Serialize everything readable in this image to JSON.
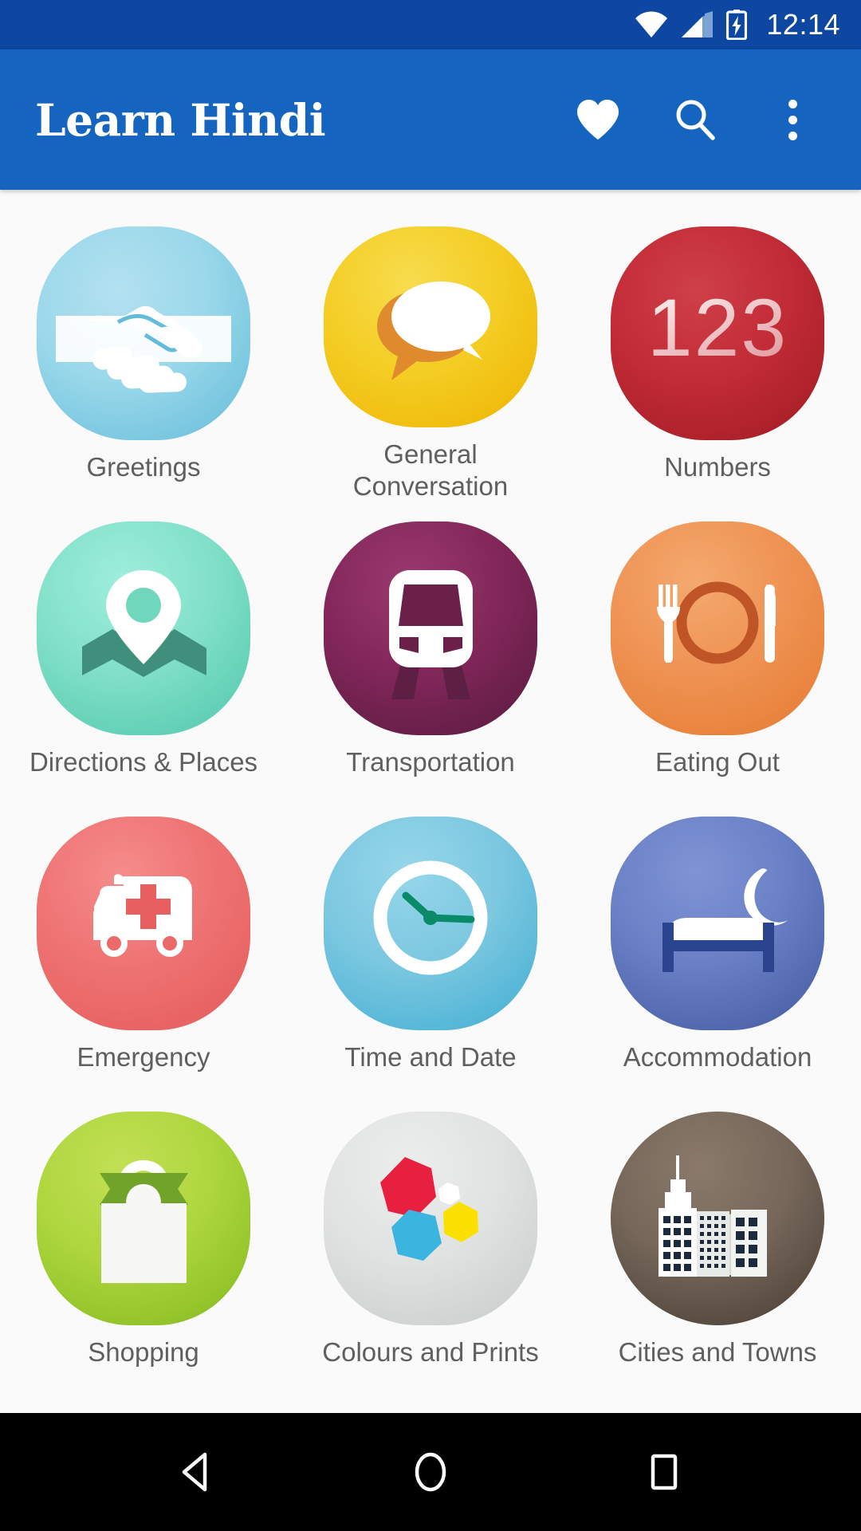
{
  "status_bar": {
    "time": "12:14",
    "icons": [
      "wifi-icon",
      "cellular-signal-icon",
      "battery-charging-icon"
    ],
    "background_color": "#0d47a1"
  },
  "app_bar": {
    "title": "Learn Hindi",
    "background_color": "#1565c0",
    "actions": [
      {
        "name": "favorites-icon",
        "label": "Favourites"
      },
      {
        "name": "search-icon",
        "label": "Search"
      },
      {
        "name": "overflow-menu-icon",
        "label": "More options"
      }
    ]
  },
  "grid": {
    "columns": 3,
    "tiles": [
      {
        "label": "Greetings",
        "icon": "handshake-icon",
        "bg_start": "#a5dcee",
        "bg_end": "#6cc2dd"
      },
      {
        "label": "General Conversation",
        "icon": "speech-bubbles-icon",
        "bg_start": "#f5d432",
        "bg_end": "#f0b800"
      },
      {
        "label": "Numbers",
        "icon": "numbers-123-icon",
        "bg_start": "#c8333d",
        "bg_end": "#a81d28"
      },
      {
        "label": "Directions & Places",
        "icon": "map-pin-icon",
        "bg_start": "#8fe3ce",
        "bg_end": "#5fcfb4"
      },
      {
        "label": "Transportation",
        "icon": "train-icon",
        "bg_start": "#8e2e62",
        "bg_end": "#5d1a42"
      },
      {
        "label": "Eating Out",
        "icon": "cutlery-plate-icon",
        "bg_start": "#f09a5a",
        "bg_end": "#e8833c"
      },
      {
        "label": "Emergency",
        "icon": "ambulance-icon",
        "bg_start": "#ef7a7a",
        "bg_end": "#e85c5c"
      },
      {
        "label": "Time and Date",
        "icon": "clock-icon",
        "bg_start": "#7ecbe4",
        "bg_end": "#47b3d6"
      },
      {
        "label": "Accommodation",
        "icon": "bed-moon-icon",
        "bg_start": "#6f86c9",
        "bg_end": "#4a63b5"
      },
      {
        "label": "Shopping",
        "icon": "shopping-bag-icon",
        "bg_start": "#b5d945",
        "bg_end": "#8cc02a"
      },
      {
        "label": "Colours and Prints",
        "icon": "hexagons-icon",
        "bg_start": "#e2e4e3",
        "bg_end": "#cdd1d0"
      },
      {
        "label": "Cities and Towns",
        "icon": "city-skyline-icon",
        "bg_start": "#7a6a5c",
        "bg_end": "#4e423a"
      }
    ]
  },
  "nav_bar": {
    "background_color": "#000000",
    "buttons": [
      {
        "name": "back-button",
        "label": "Back"
      },
      {
        "name": "home-button",
        "label": "Home"
      },
      {
        "name": "recents-button",
        "label": "Recents"
      }
    ]
  }
}
